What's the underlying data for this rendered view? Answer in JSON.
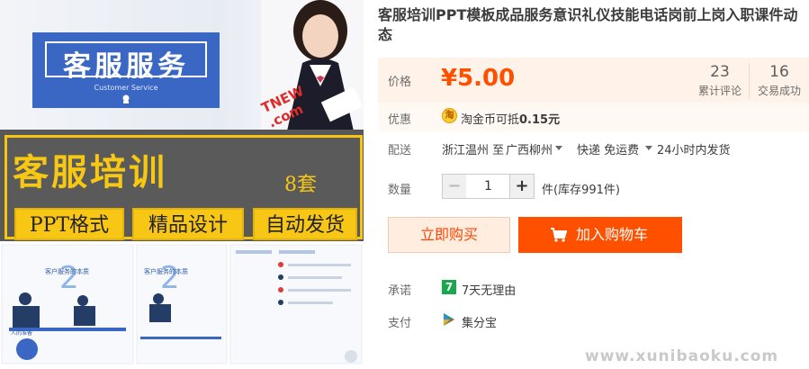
{
  "image": {
    "banner_title": "客服服务",
    "banner_subtitle": "Customer Service",
    "stamp_text": "TNEW .com",
    "main_title": "客服培训",
    "set_count": "8套",
    "pills": [
      "PPT格式",
      "精品设计",
      "自动发货"
    ],
    "slide_number": "2",
    "slide_caption": "客户服务的本质"
  },
  "product": {
    "title": "客服培训PPT模板成品服务意识礼仪技能电话岗前上岗入职课件动态"
  },
  "price": {
    "label": "价格",
    "value": "¥5.00",
    "reviews_count": "23",
    "reviews_label": "累计评论",
    "sales_count": "16",
    "sales_label": "交易成功"
  },
  "promo": {
    "label": "优惠",
    "icon": "淘",
    "text_prefix": "淘金币可抵",
    "amount": "0.15元"
  },
  "shipping": {
    "label": "配送",
    "from": "浙江温州 至",
    "to": "广西柳州",
    "method": "快递 免运费",
    "dispatch": "24小时内发货"
  },
  "quantity": {
    "label": "数量",
    "minus": "−",
    "value": "1",
    "plus": "+",
    "stock": "件(库存991件)"
  },
  "actions": {
    "buy_now": "立即购买",
    "add_to_cart": "加入购物车"
  },
  "promise": {
    "label": "承诺",
    "icon_text": "7",
    "text": "7天无理由"
  },
  "payment": {
    "label": "支付",
    "text": "集分宝"
  },
  "watermark": "www.xunibaoku.com",
  "colors": {
    "price": "#ff5000",
    "banner_blue": "#3b67c4",
    "highlight_yellow": "#f6c814",
    "promise_green": "#1aa84e"
  }
}
